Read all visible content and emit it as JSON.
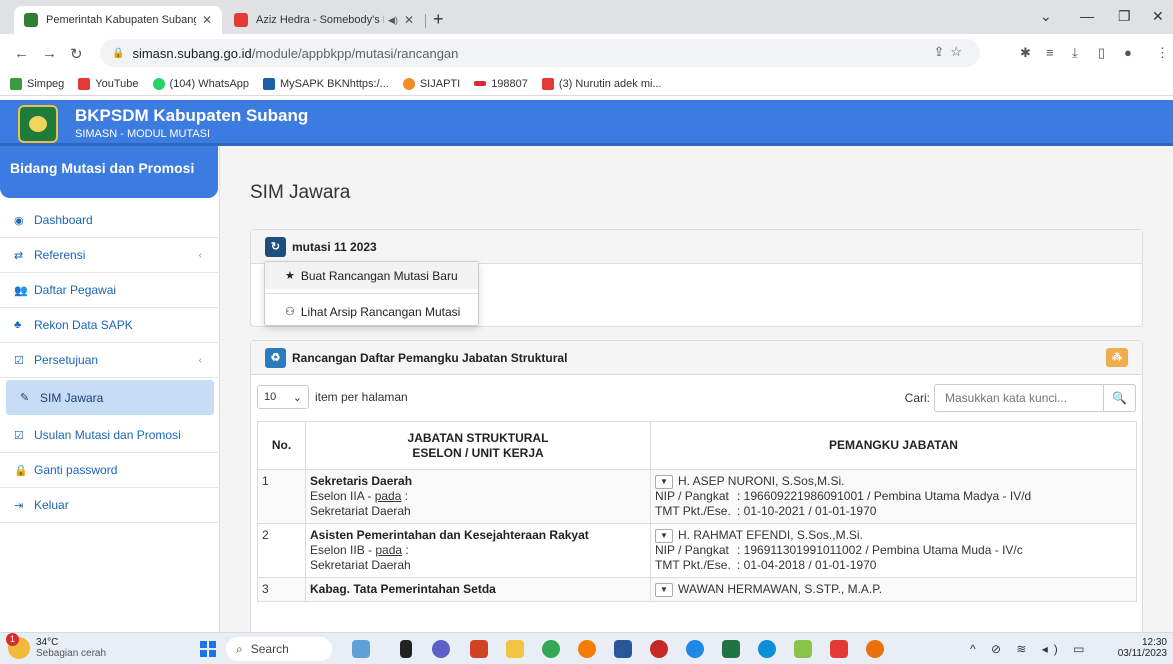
{
  "browser": {
    "tabs": [
      {
        "title": "Pemerintah Kabupaten Subang",
        "active": true,
        "favicon_color": "#2e7d32"
      },
      {
        "title": "Aziz Hedra - Somebody's Pl",
        "active": false,
        "favicon_color": "#e53935"
      }
    ],
    "url_host": "simasn.subang.go.id",
    "url_path": "/module/appbkpp/mutasi/rancangan",
    "bookmarks": [
      {
        "label": "Simpeg",
        "color": "#3a9b44"
      },
      {
        "label": "YouTube",
        "color": "#e53935"
      },
      {
        "label": "(104) WhatsApp",
        "color": "#25d366"
      },
      {
        "label": "MySAPK BKNhttps:/...",
        "color": "#1f5fa8"
      },
      {
        "label": "SIJAPTI",
        "color": "#f28c28"
      },
      {
        "label": "198807",
        "color": "#d32f2f"
      },
      {
        "label": "(3) Nurutin adek mi...",
        "color": "#e53935"
      }
    ]
  },
  "header": {
    "title": "BKPSDM Kabupaten Subang",
    "subtitle": "SIMASN - MODUL MUTASI"
  },
  "sidebar": {
    "heading": "Bidang Mutasi dan Promosi",
    "items": [
      {
        "label": "Dashboard",
        "icon": "dashboard-icon"
      },
      {
        "label": "Referensi",
        "icon": "exchange-icon",
        "chevron": true
      },
      {
        "label": "Daftar Pegawai",
        "icon": "users-icon"
      },
      {
        "label": "Rekon Data SAPK",
        "icon": "sitemap-icon"
      },
      {
        "label": "Persetujuan",
        "icon": "check-square-icon",
        "chevron": true
      },
      {
        "label": "SIM Jawara",
        "icon": "wrench-icon",
        "active": true
      },
      {
        "label": "Usulan Mutasi dan Promosi",
        "icon": "check-square-icon"
      },
      {
        "label": "Ganti password",
        "icon": "lock-icon"
      },
      {
        "label": "Keluar",
        "icon": "sign-out-icon"
      }
    ]
  },
  "main": {
    "page_title": "SIM Jawara",
    "panel1": {
      "title": "mutasi 11 2023",
      "menu": [
        "Buat Rancangan Mutasi Baru",
        "Lihat Arsip Rancangan Mutasi"
      ]
    },
    "panel2": {
      "title": "Rancangan Daftar Pemangku Jabatan Struktural",
      "per_page_value": "10",
      "per_page_label": "item per halaman",
      "search_label": "Cari:",
      "search_placeholder": "Masukkan kata kunci...",
      "columns": [
        "No.",
        "JABATAN STRUKTURAL",
        "ESELON / UNIT KERJA",
        "PEMANGKU JABATAN"
      ],
      "rows": [
        {
          "no": "1",
          "jabatan": "Sekretaris Daerah",
          "eselon": "Eselon IIA - ",
          "pada": "pada",
          "unit": "Sekretariat Daerah",
          "nama": "H. ASEP NURONI, S.Sos,M.Si.",
          "nip_label": "NIP / Pangkat",
          "nip_value": ": 196609221986091001 / Pembina Utama Madya - IV/d",
          "tmt_label": "TMT Pkt./Ese.",
          "tmt_value": ": 01-10-2021 / 01-01-1970"
        },
        {
          "no": "2",
          "jabatan": "Asisten Pemerintahan dan Kesejahteraan Rakyat",
          "eselon": "Eselon IIB - ",
          "pada": "pada",
          "unit": "Sekretariat Daerah",
          "nama": "H. RAHMAT EFENDI, S.Sos.,M.Si.",
          "nip_label": "NIP / Pangkat",
          "nip_value": ": 196911301991011002 / Pembina Utama Muda - IV/c",
          "tmt_label": "TMT Pkt./Ese.",
          "tmt_value": ": 01-04-2018 / 01-01-1970"
        },
        {
          "no": "3",
          "jabatan": "Kabag. Tata Pemerintahan Setda",
          "nama": "WAWAN HERMAWAN, S.STP., M.A.P."
        }
      ]
    }
  },
  "taskbar": {
    "temp": "34°C",
    "weather": "Sebagian cerah",
    "badge": "1",
    "search": "Search",
    "time": "12:30",
    "date": "03/11/2023"
  }
}
